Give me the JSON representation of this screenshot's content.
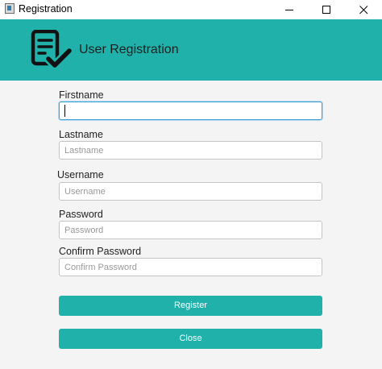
{
  "window": {
    "title": "Registration"
  },
  "header": {
    "title": "User Registration",
    "icon": "clipboard-check-icon",
    "background": "#20b2aa"
  },
  "form": {
    "fields": [
      {
        "label": "Firstname",
        "value": "",
        "placeholder": "",
        "focused": true
      },
      {
        "label": "Lastname",
        "value": "",
        "placeholder": "Lastname"
      },
      {
        "label": "Username",
        "value": "",
        "placeholder": "Username"
      },
      {
        "label": "Password",
        "value": "",
        "placeholder": "Password"
      },
      {
        "label": "Confirm Password",
        "value": "",
        "placeholder": "Confirm Password"
      }
    ],
    "register_label": "Register",
    "close_label": "Close",
    "accent_color": "#20b2aa",
    "focus_color": "#3a9fd6"
  }
}
